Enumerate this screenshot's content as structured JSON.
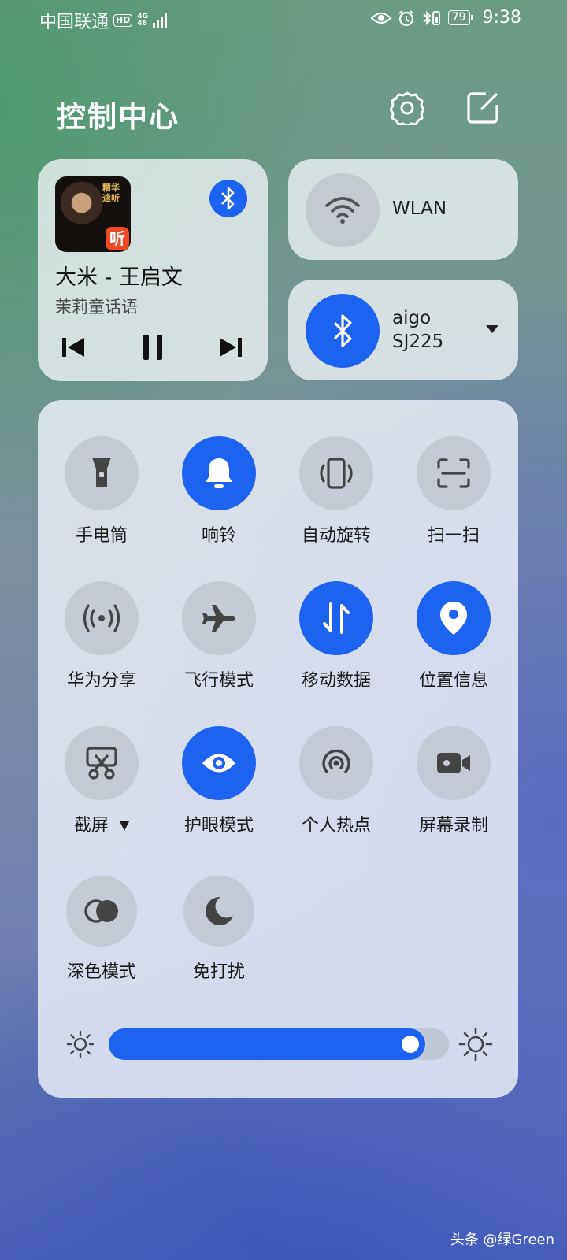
{
  "status_bar": {
    "carrier": "中国联通",
    "hd": "HD",
    "net_top": "4G",
    "net_bottom": "46",
    "battery": "79",
    "time": "9:38",
    "icons": [
      "eye-comfort-icon",
      "alarm-icon",
      "bluetooth-vibrate-icon"
    ]
  },
  "header": {
    "title": "控制中心",
    "settings_icon": "gear-icon",
    "edit_icon": "edit-icon"
  },
  "media": {
    "cover_text": "精华速听",
    "cover_badge": "听",
    "song_title": "大米 - 王启文",
    "artist": "茉莉童话语",
    "output_icon": "bluetooth-icon"
  },
  "wlan": {
    "label": "WLAN",
    "active": false
  },
  "bluetooth": {
    "device_line1": "aigo",
    "device_line2": "SJ225",
    "active": true
  },
  "toggles": [
    {
      "label": "手电筒",
      "icon": "flashlight-icon",
      "on": false
    },
    {
      "label": "响铃",
      "icon": "bell-icon",
      "on": true
    },
    {
      "label": "自动旋转",
      "icon": "auto-rotate-icon",
      "on": false
    },
    {
      "label": "扫一扫",
      "icon": "scan-icon",
      "on": false
    },
    {
      "label": "华为分享",
      "icon": "share-icon",
      "on": false
    },
    {
      "label": "飞行模式",
      "icon": "airplane-icon",
      "on": false
    },
    {
      "label": "移动数据",
      "icon": "mobile-data-icon",
      "on": true
    },
    {
      "label": "位置信息",
      "icon": "location-icon",
      "on": true
    },
    {
      "label": "截屏",
      "icon": "screenshot-icon",
      "on": false
    },
    {
      "label": "护眼模式",
      "icon": "eye-icon",
      "on": true
    },
    {
      "label": "个人热点",
      "icon": "hotspot-icon",
      "on": false
    },
    {
      "label": "屏幕录制",
      "icon": "video-icon",
      "on": false
    },
    {
      "label": "深色模式",
      "icon": "dark-mode-icon",
      "on": false
    },
    {
      "label": "免打扰",
      "icon": "moon-icon",
      "on": false
    }
  ],
  "brightness": {
    "level": 0.93
  },
  "colors": {
    "accent": "#1c63f2"
  },
  "watermark": "头条 @绿Green"
}
